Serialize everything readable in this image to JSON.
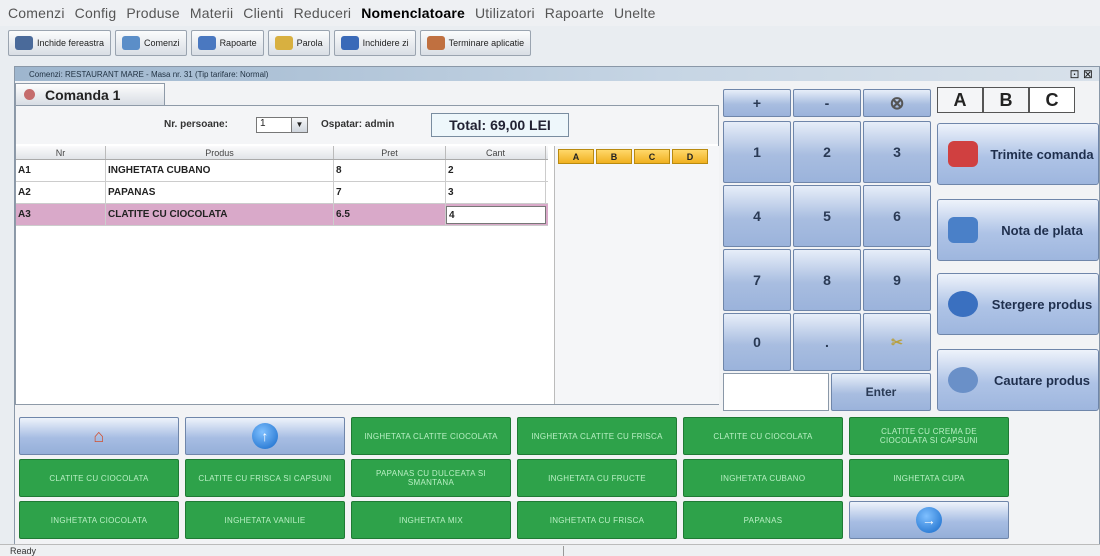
{
  "menu": [
    "Comenzi",
    "Config",
    "Produse",
    "Materii",
    "Clienti",
    "Reduceri",
    "Nomenclatoare",
    "Utilizatori",
    "Rapoarte",
    "Unelte"
  ],
  "toolbar": [
    {
      "label": "Inchide fereastra",
      "icon": "close-circle-icon",
      "color": "#4a6a9a"
    },
    {
      "label": "Comenzi",
      "icon": "orders-icon",
      "color": "#5b8ec8"
    },
    {
      "label": "Rapoarte",
      "icon": "reports-icon",
      "color": "#4a78c0"
    },
    {
      "label": "Parola",
      "icon": "password-key-icon",
      "color": "#d8b040"
    },
    {
      "label": "Inchidere zi",
      "icon": "close-day-icon",
      "color": "#3a6ab8"
    },
    {
      "label": "Terminare aplicatie",
      "icon": "exit-app-icon",
      "color": "#c07040"
    }
  ],
  "window": {
    "title": "Comenzi: RESTAURANT MARE - Masa nr. 31 (Tip tarifare: Normal)",
    "controls": "⊡ ⊠"
  },
  "order": {
    "tab_label": "Comanda 1",
    "persons_label": "Nr. persoane:",
    "persons_value": "1",
    "waiter_label": "Ospatar: admin",
    "total": "Total: 69,00 LEI",
    "columns": [
      "Nr",
      "Produs",
      "Pret",
      "Cant"
    ],
    "rows": [
      {
        "nr": "A1",
        "produs": "INGHETATA CUBANO",
        "pret": "8",
        "cant": "2"
      },
      {
        "nr": "A2",
        "produs": "PAPANAS",
        "pret": "7",
        "cant": "3"
      },
      {
        "nr": "A3",
        "produs": "CLATITE CU CIOCOLATA",
        "pret": "6.5",
        "cant": "4"
      }
    ]
  },
  "abcd_tabs": [
    "A",
    "B",
    "C",
    "D"
  ],
  "keypad": {
    "top": [
      "+",
      "-",
      "⊗"
    ],
    "digits": [
      "1",
      "2",
      "3",
      "4",
      "5",
      "6",
      "7",
      "8",
      "9",
      "0",
      "."
    ],
    "enter": "Enter"
  },
  "price_tabs": [
    "A",
    "B",
    "C"
  ],
  "actions": [
    {
      "label": "Trimite comanda",
      "icon": "rocket-icon",
      "color": "#d04040"
    },
    {
      "label": "Nota de plata",
      "icon": "folder-open-icon",
      "color": "#4a80c8"
    },
    {
      "label": "Stergere produs",
      "icon": "database-delete-icon",
      "color": "#3a70c0"
    },
    {
      "label": "Cautare produs",
      "icon": "search-magnifier-icon",
      "color": "#6a90c8"
    }
  ],
  "product_buttons": [
    "INGHETATA CLATITE CIOCOLATA",
    "INGHETATA CLATITE CU FRISCA",
    "CLATITE CU CIOCOLATA",
    "CLATITE CU CREMA DE CIOCOLATA SI CAPSUNI",
    "CLATITE CU CIOCOLATA",
    "CLATITE CU FRISCA SI CAPSUNI",
    "PAPANAS CU DULCEATA SI SMANTANA",
    "INGHETATA CU FRUCTE",
    "INGHETATA CUBANO",
    "INGHETATA CUPA",
    "INGHETATA CIOCOLATA",
    "INGHETATA VANILIE",
    "INGHETATA MIX",
    "INGHETATA CU FRISCA",
    "PAPANAS"
  ],
  "status": "Ready"
}
